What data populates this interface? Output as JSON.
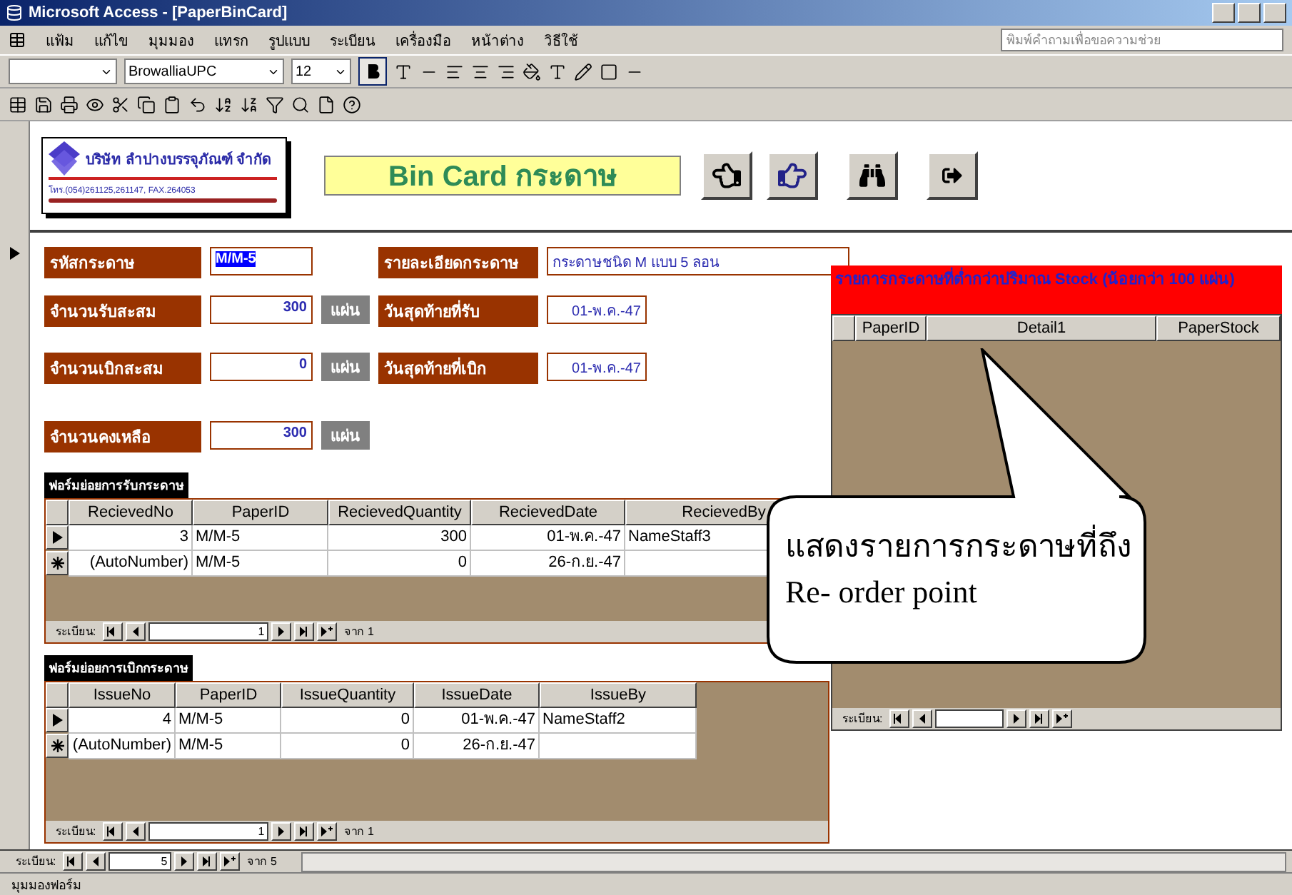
{
  "window": {
    "title": "Microsoft Access - [PaperBinCard]"
  },
  "menu": [
    "แฟ้ม",
    "แก้ไข",
    "มุมมอง",
    "แทรก",
    "รูปแบบ",
    "ระเบียน",
    "เครื่องมือ",
    "หน้าต่าง",
    "วิธีใช้"
  ],
  "help_box": {
    "placeholder": "พิมพ์คำถามเพื่อขอความช่วย"
  },
  "format_toolbar": {
    "font": "BrowalliaUPC",
    "size": "12",
    "bold": true
  },
  "header": {
    "company": "บริษัท ลำปางบรรจุภัณฑ์ จำกัด",
    "phone": "โทร.(054)261125,261147, FAX.264053",
    "title": "Bin Card กระดาษ"
  },
  "left_fields": [
    {
      "label": "รหัสกระดาษ",
      "value": "M/M-5",
      "selected": true
    },
    {
      "label": "จำนวนรับสะสม",
      "value": "300",
      "unit": "แผ่น",
      "selected": false
    },
    {
      "label": "จำนวนเบิกสะสม",
      "value": "0",
      "unit": "แผ่น",
      "selected": false
    },
    {
      "label": "จำนวนคงเหลือ",
      "value": "300",
      "unit": "แผ่น",
      "selected": false
    }
  ],
  "right_fields": [
    {
      "label": "รายละเอียดกระดาษ",
      "value": "กระดาษชนิด M แบบ 5 ลอน",
      "kind": "wide"
    },
    {
      "label": "วันสุดท้ายที่รับ",
      "value": "01-พ.ค.-47",
      "kind": "date"
    },
    {
      "label": "วันสุดท้ายที่เบิก",
      "value": "01-พ.ค.-47",
      "kind": "date"
    }
  ],
  "received_subform": {
    "title": "ฟอร์มย่อยการรับกระดาษ",
    "columns": [
      {
        "label": "RecievedNo",
        "kind": "number"
      },
      {
        "label": "PaperID",
        "kind": "text"
      },
      {
        "label": "RecievedQuantity",
        "kind": "number"
      },
      {
        "label": "RecievedDate",
        "kind": "number"
      },
      {
        "label": "RecievedBy",
        "kind": "text"
      }
    ],
    "rows": [
      {
        "kind": "current",
        "cells": [
          "3",
          "M/M-5",
          "300",
          "01-พ.ค.-47",
          "NameStaff3"
        ]
      },
      {
        "kind": "new",
        "cells": [
          "(AutoNumber)",
          "M/M-5",
          "0",
          "26-ก.ย.-47",
          ""
        ]
      }
    ],
    "nav": {
      "label": "ระเบียน:",
      "record": "1",
      "of": "จาก  1"
    }
  },
  "issue_subform": {
    "title": "ฟอร์มย่อยการเบิกกระดาษ",
    "columns": [
      {
        "label": "IssueNo",
        "kind": "number"
      },
      {
        "label": "PaperID",
        "kind": "text"
      },
      {
        "label": "IssueQuantity",
        "kind": "number"
      },
      {
        "label": "IssueDate",
        "kind": "number"
      },
      {
        "label": "IssueBy",
        "kind": "text"
      }
    ],
    "rows": [
      {
        "kind": "current",
        "cells": [
          "4",
          "M/M-5",
          "0",
          "01-พ.ค.-47",
          "NameStaff2"
        ]
      },
      {
        "kind": "new",
        "cells": [
          "(AutoNumber)",
          "M/M-5",
          "0",
          "26-ก.ย.-47",
          ""
        ]
      }
    ],
    "nav": {
      "label": "ระเบียน:",
      "record": "1",
      "of": "จาก  1"
    }
  },
  "low_stock": {
    "title": "รายการกระดาษที่ต่ำกว่าปริมาณ Stock (น้อยกว่า 100 แผ่น)",
    "columns": [
      "PaperID",
      "Detail1",
      "PaperStock"
    ],
    "nav_label": "ระเบียน:"
  },
  "callout": {
    "lines": [
      "แสดงรายการกระดาษที่ถึง",
      "Re- order point"
    ]
  },
  "record_nav": {
    "label": "ระเบียน:",
    "record": "5",
    "of": "จาก 5"
  },
  "status_bar": "มุมมองฟอร์ม"
}
